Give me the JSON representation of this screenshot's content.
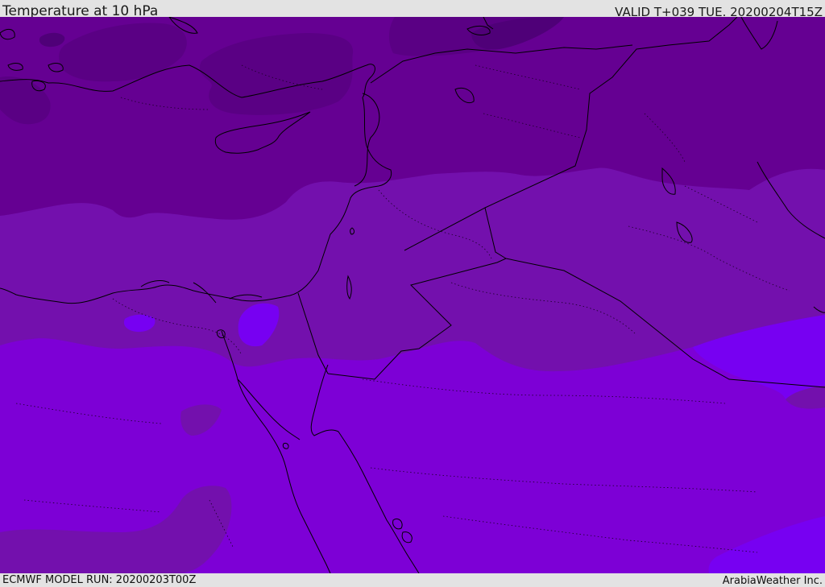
{
  "header": {
    "title": "Temperature at 10 hPa",
    "valid_time": "VALID T+039 TUE. 20200204T15Z"
  },
  "footer": {
    "model_run": "ECMWF MODEL RUN: 20200203T00Z",
    "credit": "ArabiaWeather Inc."
  },
  "map": {
    "region": "Eastern Mediterranean & Middle East",
    "field": "temperature-10hPa",
    "palette": {
      "coldest": "#4f0078",
      "colder": "#5a0084",
      "cold": "#650092",
      "cool": "#7310ad",
      "mild": "#7d00d6",
      "warm": "#7700f2",
      "coastline": "#000000",
      "border": "#000000"
    }
  }
}
